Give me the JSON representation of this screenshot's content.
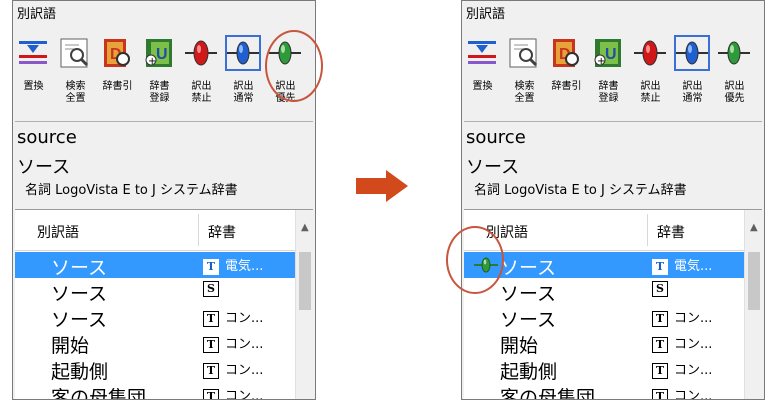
{
  "panel_title": "別訳語",
  "toolbar": [
    {
      "id": "replace",
      "label": "置換",
      "icon": "replace-icon",
      "selected": false
    },
    {
      "id": "search",
      "label": "検索\n全置",
      "icon": "search-icon",
      "selected": false
    },
    {
      "id": "dictlookup",
      "label": "辞書引",
      "icon": "dictionary-lookup-icon",
      "selected": false
    },
    {
      "id": "dictreg",
      "label": "辞書\n登録",
      "icon": "dictionary-register-icon",
      "selected": false
    },
    {
      "id": "prohibit",
      "label": "訳出\n禁止",
      "icon": "prohibit-icon",
      "selected": false
    },
    {
      "id": "normal",
      "label": "訳出\n通常",
      "icon": "normal-icon",
      "selected": true
    },
    {
      "id": "priority",
      "label": "訳出\n優先",
      "icon": "priority-icon",
      "selected": false
    }
  ],
  "entry": {
    "source": "source",
    "reading": "ソース",
    "pos_line": "名詞  LogoVista E to J システム辞書"
  },
  "list": {
    "col_word": "別訳語",
    "col_dict": "辞書",
    "rows_before": [
      {
        "word": "ソース",
        "dict_icon": "T",
        "dict": "電気...",
        "selected": true
      },
      {
        "word": "ソース",
        "dict_icon": "S",
        "dict": "",
        "selected": false
      },
      {
        "word": "ソース",
        "dict_icon": "T",
        "dict": "コン...",
        "selected": false
      },
      {
        "word": "開始",
        "dict_icon": "T",
        "dict": "コン...",
        "selected": false
      },
      {
        "word": "起動側",
        "dict_icon": "T",
        "dict": "コン...",
        "selected": false
      },
      {
        "word": "客の母集団",
        "dict_icon": "T",
        "dict": "コン...",
        "selected": false
      }
    ],
    "rows_after": [
      {
        "word": "ソース",
        "dict_icon": "T",
        "dict": "電気...",
        "selected": true,
        "priority": true
      },
      {
        "word": "ソース",
        "dict_icon": "S",
        "dict": "",
        "selected": false
      },
      {
        "word": "ソース",
        "dict_icon": "T",
        "dict": "コン...",
        "selected": false
      },
      {
        "word": "開始",
        "dict_icon": "T",
        "dict": "コン...",
        "selected": false
      },
      {
        "word": "起動側",
        "dict_icon": "T",
        "dict": "コン...",
        "selected": false
      },
      {
        "word": "客の母集団",
        "dict_icon": "T",
        "dict": "コン...",
        "selected": false
      }
    ]
  },
  "colors": {
    "accent": "#3399ff",
    "annotation": "#c8553d",
    "arrow": "#d2491c",
    "priority_green": "#2f9a3a",
    "prohibit_red": "#d01818",
    "normal_blue": "#1f5fd0"
  }
}
